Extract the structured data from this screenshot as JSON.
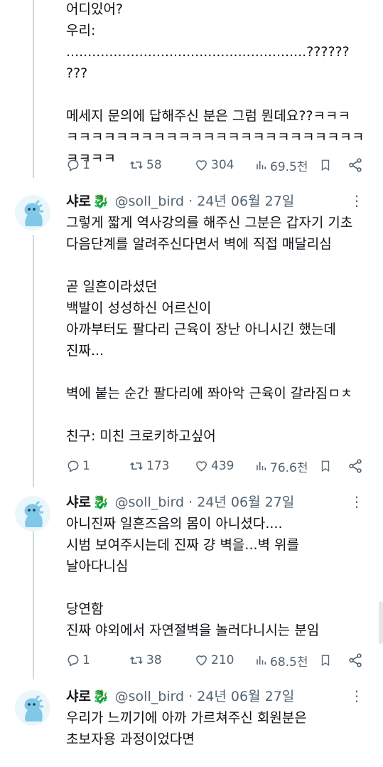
{
  "tweets": [
    {
      "text": "어디있어?\n우리: ........................................................??????\n???\n\n메세지 문의에 답해주신 분은 그럼 뭔데요??ㅋㅋㅋ\nㅋㅋㅋㅋㅋㅋㅋㅋㅋㅋㅋㅋㅋㅋㅋㅋㅋㅋㅋㅋㅋㅋㅋㅋ\nㅋㅋㅋㅋ",
      "replies": "1",
      "retweets": "58",
      "likes": "304",
      "views": "69.5천"
    },
    {
      "name": "샤로",
      "leaf": "🐉",
      "handle": "@soll_bird · 24년 06월 27일",
      "text": "그렇게 짧게 역사강의를 해주신 그분은 갑자기 기초\n다음단계를 알려주신다면서 벽에 직접 매달리심\n\n곧 일흔이라셨던\n백발이 성성하신 어르신이\n아까부터도 팔다리 근육이 장난 아니시긴 했는데\n진짜...\n\n벽에 붙는 순간 팔다리에 쫘아악 근육이 갈라짐ㅁㅊ\n\n친구: 미친 크로키하고싶어",
      "replies": "1",
      "retweets": "173",
      "likes": "439",
      "views": "76.6천"
    },
    {
      "name": "샤로",
      "leaf": "🐉",
      "handle": "@soll_bird · 24년 06월 27일",
      "text": "아니진짜 일흔즈음의 몸이 아니셨다....\n시범 보여주시는데 진짜 걍 벽을...벽 위를\n날아다니심\n\n당연함\n진짜 야외에서 자연절벽을 놀러다니시는 분임",
      "replies": "1",
      "retweets": "38",
      "likes": "210",
      "views": "68.5천"
    },
    {
      "name": "샤로",
      "leaf": "🐉",
      "handle": "@soll_bird · 24년 06월 27일",
      "text": "우리가 느끼기에 아까 가르쳐주신 회원분은\n초보자용 과정이었다면"
    }
  ],
  "icons": {
    "reply": "reply-icon",
    "retweet": "retweet-icon",
    "like": "heart-icon",
    "views": "views-chart-icon",
    "bookmark": "bookmark-icon",
    "share": "share-icon",
    "more": "more-dots-icon",
    "avatar": "blue-dino-avatar"
  },
  "colors": {
    "text": "#0f1419",
    "muted": "#536471",
    "thread": "#cfd9de",
    "avatar": "#7fc8e8"
  }
}
